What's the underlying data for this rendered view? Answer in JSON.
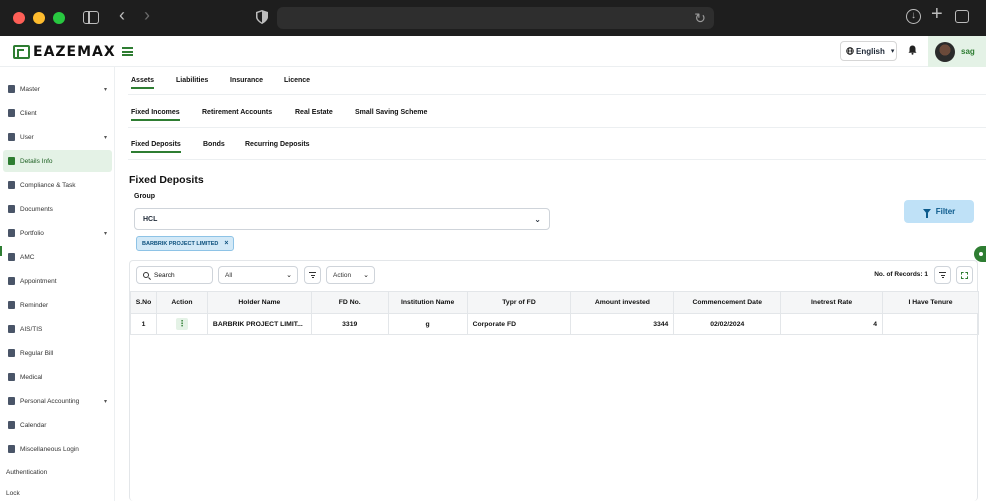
{
  "browser": {
    "url": ""
  },
  "app": {
    "logo_text": "EAZEMAX",
    "language": "English",
    "user_name": "sag"
  },
  "sidebar": {
    "items": [
      {
        "label": "Master",
        "caret": "▾"
      },
      {
        "label": "Client"
      },
      {
        "label": "User",
        "caret": "▾"
      },
      {
        "label": "Details Info",
        "active": true
      },
      {
        "label": "Compliance & Task"
      },
      {
        "label": "Documents"
      },
      {
        "label": "Portfolio",
        "caret": "▾"
      },
      {
        "label": "AMC"
      },
      {
        "label": "Appointment"
      },
      {
        "label": "Reminder"
      },
      {
        "label": "AIS/TIS"
      },
      {
        "label": "Regular Bill"
      },
      {
        "label": "Medical"
      },
      {
        "label": "Personal Accounting",
        "caret": "▾"
      },
      {
        "label": "Calendar"
      },
      {
        "label": "Miscellaneous Login"
      }
    ],
    "plain_items": [
      "Authentication",
      "Lock"
    ]
  },
  "tabs": {
    "level1": [
      "Assets",
      "Liabilities",
      "Insurance",
      "Licence"
    ],
    "level2": [
      "Fixed Incomes",
      "Retirement Accounts",
      "Real Estate",
      "Small Saving Scheme"
    ],
    "level3": [
      "Fixed Deposits",
      "Bonds",
      "Recurring Deposits"
    ]
  },
  "page": {
    "title": "Fixed Deposits",
    "group_label": "Group",
    "group_value": "HCL",
    "chip_label": "BARBRIK PROJECT LIMITED",
    "chip_remove": "×",
    "filter_label": "Filter"
  },
  "grid": {
    "search_label": "Search",
    "all_label": "All",
    "action_label": "Action",
    "records_label": "No. of Records: 1",
    "columns": [
      "S.No",
      "Action",
      "Holder Name",
      "FD No.",
      "Institution Name",
      "Typr of FD",
      "Amount invested",
      "Commencement Date",
      "Inetrest Rate",
      "I Have Tenure"
    ],
    "rows": [
      [
        "1",
        "⋮",
        "BARBRIK PROJECT LIMIT...",
        "3319",
        "g",
        "Corporate FD",
        "3344",
        "02/02/2024",
        "4",
        ""
      ]
    ]
  },
  "colors": {
    "accent": "#2e7d32",
    "accent_light": "#e4f2e6",
    "filter_bg": "#bfe1f7"
  }
}
